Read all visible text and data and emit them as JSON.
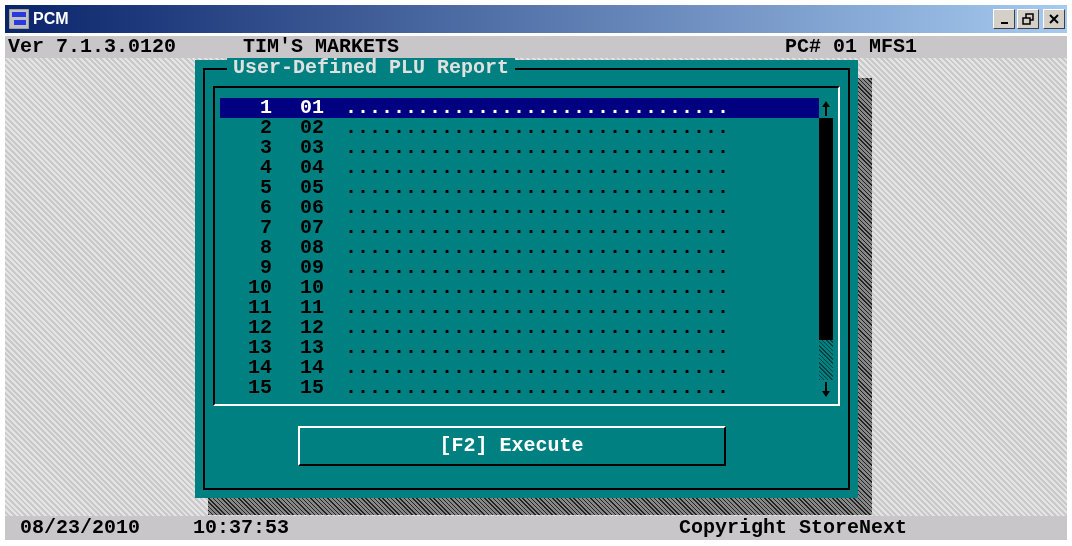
{
  "window": {
    "title": "PCM"
  },
  "header": {
    "version": "Ver 7.1.3.0120",
    "store": "TIM'S MARKETS",
    "station": "PC# 01 MFS1"
  },
  "dialog": {
    "title": "User-Defined PLU Report",
    "rows": [
      {
        "index": "1",
        "code": "01",
        "description": "................................",
        "selected": true
      },
      {
        "index": "2",
        "code": "02",
        "description": "................................",
        "selected": false
      },
      {
        "index": "3",
        "code": "03",
        "description": "................................",
        "selected": false
      },
      {
        "index": "4",
        "code": "04",
        "description": "................................",
        "selected": false
      },
      {
        "index": "5",
        "code": "05",
        "description": "................................",
        "selected": false
      },
      {
        "index": "6",
        "code": "06",
        "description": "................................",
        "selected": false
      },
      {
        "index": "7",
        "code": "07",
        "description": "................................",
        "selected": false
      },
      {
        "index": "8",
        "code": "08",
        "description": "................................",
        "selected": false
      },
      {
        "index": "9",
        "code": "09",
        "description": "................................",
        "selected": false
      },
      {
        "index": "10",
        "code": "10",
        "description": "................................",
        "selected": false
      },
      {
        "index": "11",
        "code": "11",
        "description": "................................",
        "selected": false
      },
      {
        "index": "12",
        "code": "12",
        "description": "................................",
        "selected": false
      },
      {
        "index": "13",
        "code": "13",
        "description": "................................",
        "selected": false
      },
      {
        "index": "14",
        "code": "14",
        "description": "................................",
        "selected": false
      },
      {
        "index": "15",
        "code": "15",
        "description": "................................",
        "selected": false
      }
    ],
    "button": "[F2] Execute"
  },
  "status_bar": {
    "date": "08/23/2010",
    "time": "10:37:53",
    "copyright": "Copyright StoreNext"
  }
}
